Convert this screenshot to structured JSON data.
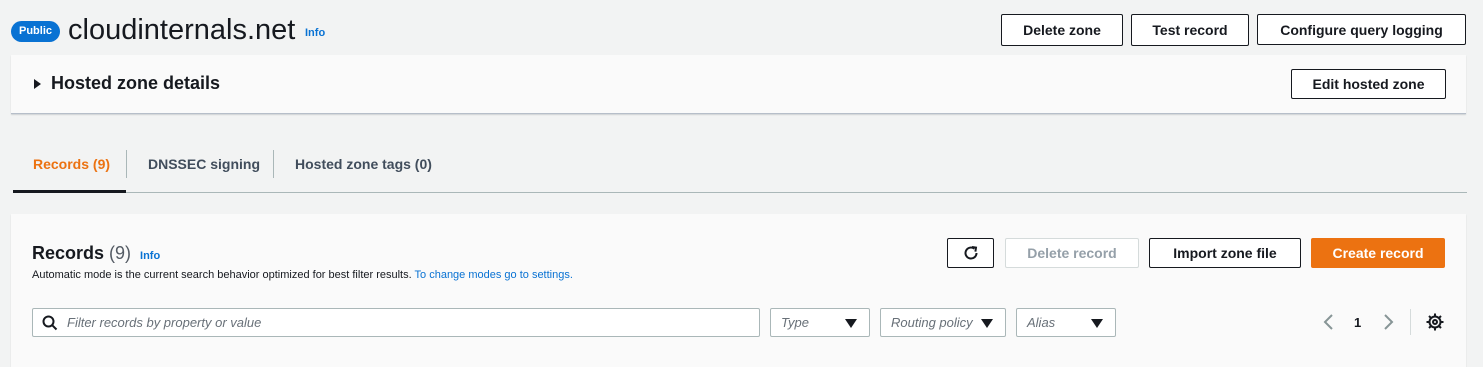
{
  "header": {
    "badge": "Public",
    "zone_name": "cloudinternals.net",
    "info": "Info",
    "actions": {
      "delete_zone": "Delete zone",
      "test_record": "Test record",
      "configure_query_logging": "Configure query logging"
    }
  },
  "details": {
    "title": "Hosted zone details",
    "edit_button": "Edit hosted zone"
  },
  "tabs": [
    {
      "label": "Records (9)",
      "active": true
    },
    {
      "label": "DNSSEC signing",
      "active": false
    },
    {
      "label": "Hosted zone tags (0)",
      "active": false
    }
  ],
  "records": {
    "title": "Records",
    "count": "(9)",
    "info": "Info",
    "description": "Automatic mode is the current search behavior optimized for best filter results.",
    "description_link": "To change modes go to settings.",
    "actions": {
      "refresh_icon": "refresh-icon",
      "delete_record": "Delete record",
      "import_zone_file": "Import zone file",
      "create_record": "Create record"
    },
    "search_placeholder": "Filter records by property or value",
    "filters": {
      "type": "Type",
      "routing_policy": "Routing policy",
      "alias": "Alias"
    },
    "pagination": {
      "current_page": "1"
    }
  },
  "colors": {
    "accent": "#ec7211",
    "link": "#0972d3",
    "badge": "#0972d3",
    "background": "#f2f3f3"
  }
}
